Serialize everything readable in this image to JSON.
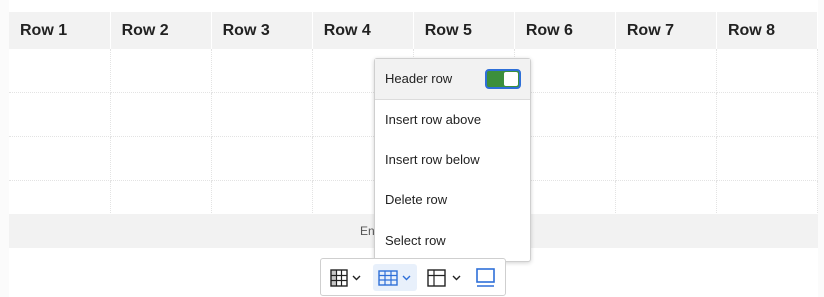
{
  "table": {
    "headers": [
      "Row 1",
      "Row 2",
      "Row 3",
      "Row 4",
      "Row 5",
      "Row 6",
      "Row 7",
      "Row 8"
    ],
    "body_rows": 4,
    "footer_text": "En"
  },
  "context_menu": {
    "header_row_label": "Header row",
    "header_row_toggle_on": true,
    "items": [
      {
        "label": "Insert row above"
      },
      {
        "label": "Insert row below"
      },
      {
        "label": "Delete row"
      },
      {
        "label": "Select row"
      }
    ]
  },
  "toolbar": {
    "buttons": [
      {
        "icon": "table-icon"
      },
      {
        "icon": "table-row-icon",
        "active": true
      },
      {
        "icon": "table-merge-icon"
      },
      {
        "icon": "display-icon"
      }
    ]
  },
  "colors": {
    "toggle_on": "#3c8f3c",
    "focus_blue": "#2e6fd8",
    "header_bg": "#f2f2f2"
  }
}
